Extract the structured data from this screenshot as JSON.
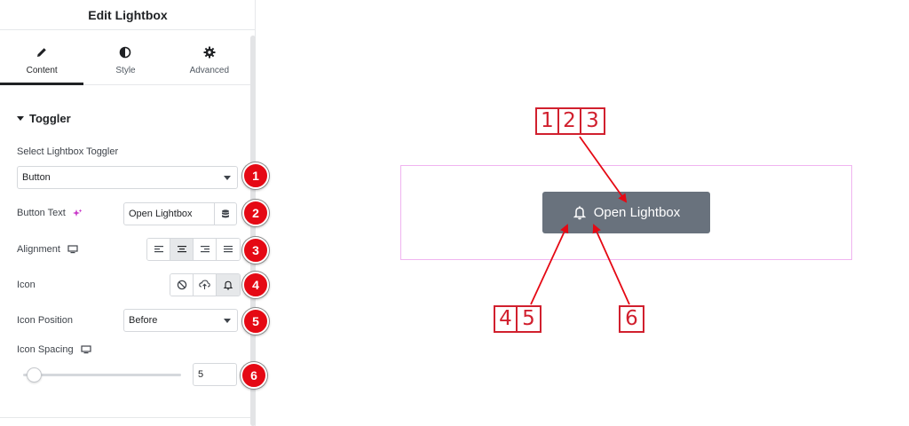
{
  "panel": {
    "title": "Edit Lightbox",
    "tabs": [
      {
        "label": "Content",
        "icon": "pencil-icon",
        "active": true
      },
      {
        "label": "Style",
        "icon": "half-circle-icon",
        "active": false
      },
      {
        "label": "Advanced",
        "icon": "gear-icon",
        "active": false
      }
    ],
    "section": "Toggler",
    "fields": {
      "toggler_label": "Select Lightbox Toggler",
      "toggler_value": "Button",
      "button_text_label": "Button Text",
      "button_text_value": "Open Lightbox",
      "alignment_label": "Alignment",
      "alignment_options": [
        "align-left-icon",
        "align-center-icon",
        "align-right-icon",
        "align-justify-icon"
      ],
      "alignment_selected": "align-center-icon",
      "icon_label": "Icon",
      "icon_options": [
        "none-icon",
        "upload-icon",
        "bell-icon"
      ],
      "icon_selected": "bell-icon",
      "icon_position_label": "Icon Position",
      "icon_position_value": "Before",
      "icon_spacing_label": "Icon Spacing",
      "icon_spacing_value": "5",
      "icon_spacing_fraction": 0.05
    },
    "markers": [
      "1",
      "2",
      "3",
      "4",
      "5",
      "6"
    ]
  },
  "preview": {
    "button_label": "Open Lightbox",
    "button_icon": "bell-icon",
    "button_color": "#69727d",
    "callouts": [
      {
        "digits": [
          "1",
          "2",
          "3"
        ]
      },
      {
        "digits": [
          "4",
          "5"
        ]
      },
      {
        "digits": [
          "6"
        ]
      }
    ]
  },
  "colors": {
    "marker": "#e50914",
    "callout": "#d1202e",
    "preview_border": "#f0b4f0"
  }
}
